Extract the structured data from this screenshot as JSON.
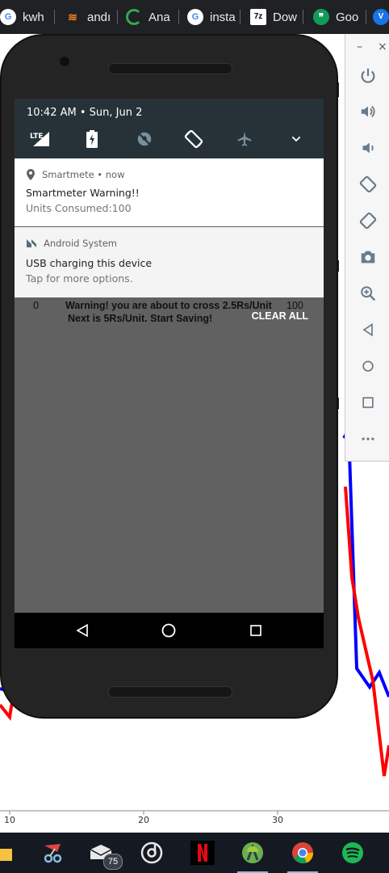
{
  "browser": {
    "tabs": [
      {
        "label": "kwh",
        "icon": "google-icon"
      },
      {
        "label": "andı",
        "icon": "stackoverflow-icon"
      },
      {
        "label": "Ana",
        "icon": "loading-spinner-icon"
      },
      {
        "label": "insta",
        "icon": "google-icon"
      },
      {
        "label": "Dow",
        "icon": "7zip-icon",
        "icon_text": "7z"
      },
      {
        "label": "Goo",
        "icon": "hangouts-icon"
      },
      {
        "label": "",
        "icon": "vpn-extension-icon"
      }
    ]
  },
  "background_chart": {
    "x_ticks": [
      "10",
      "20",
      "30"
    ],
    "series_colors": [
      "#0000ff",
      "#ff0000"
    ]
  },
  "emulator_toolbar": {
    "minimize_label": "–",
    "close_label": "×",
    "buttons": [
      "power-icon",
      "volume-up-icon",
      "volume-down-icon",
      "rotate-left-icon",
      "rotate-right-icon",
      "camera-icon",
      "zoom-icon",
      "back-icon",
      "home-icon",
      "overview-icon",
      "more-icon"
    ]
  },
  "phone": {
    "status": {
      "clock": "10:42 AM • Sun, Jun 2",
      "lte_label": "LTE"
    },
    "quick_settings": [
      "lte-signal-icon",
      "battery-charging-icon",
      "location-off-icon",
      "auto-rotate-icon",
      "airplane-mode-icon",
      "expand-chevron-icon"
    ],
    "notifications": [
      {
        "app": "Smartmete • now",
        "title": "Smartmeter Warning!!",
        "body": "Units Consumed:100",
        "icon": "location-pin-icon"
      },
      {
        "app": "Android System",
        "title": "USB charging this device",
        "body": "Tap for more options.",
        "icon": "android-n-icon"
      }
    ],
    "clear_all": "CLEAR ALL",
    "app": {
      "left_value": "0",
      "right_value": "100",
      "warning_line1": "Warning! you are about to cross 2.5Rs/Unit",
      "warning_line2": "Next is 5Rs/Unit. Start Saving!"
    },
    "nav": [
      "back-triangle-icon",
      "home-circle-icon",
      "recents-square-icon"
    ]
  },
  "taskbar": {
    "mail_badge": "75",
    "items": [
      "file-explorer-icon",
      "snipping-tool-icon",
      "mail-icon",
      "groove-music-icon",
      "netflix-icon",
      "android-studio-icon",
      "chrome-icon",
      "spotify-icon"
    ]
  }
}
